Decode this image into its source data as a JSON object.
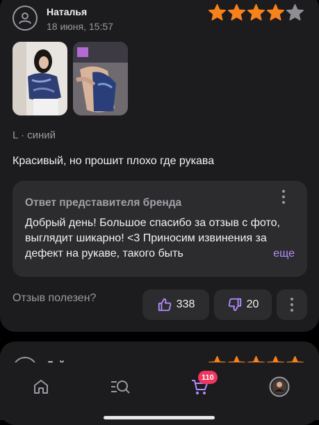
{
  "review": {
    "author": "Наталья",
    "date": "18 июня, 15:57",
    "rating": 4,
    "rating_max": 5,
    "variant": "L · синий",
    "text": "Красивый, но прошит плохо где рукава",
    "photos": [
      "photo-1",
      "photo-2"
    ],
    "reply": {
      "title": "Ответ представителя бренда",
      "body": "Добрый день! Большое спасибо за отзыв с фото, выглядит шикарно! <3 Приносим извинения за дефект на рукаве, такого быть",
      "more_label": "еще"
    },
    "helpful_label": "Отзыв полезен?",
    "likes": "338",
    "dislikes": "20"
  },
  "next_review": {
    "author": "Лейла",
    "rating": 5
  },
  "tabbar": {
    "items": [
      "home-icon",
      "catalog-search-icon",
      "cart-icon",
      "profile-avatar"
    ],
    "cart_badge": "110"
  },
  "colors": {
    "star_filled": "#f7821b",
    "star_empty": "#8e8e93",
    "accent": "#b48cff",
    "badge": "#f0355e",
    "card": "#1c1c1e",
    "panel": "#2c2c2e"
  }
}
